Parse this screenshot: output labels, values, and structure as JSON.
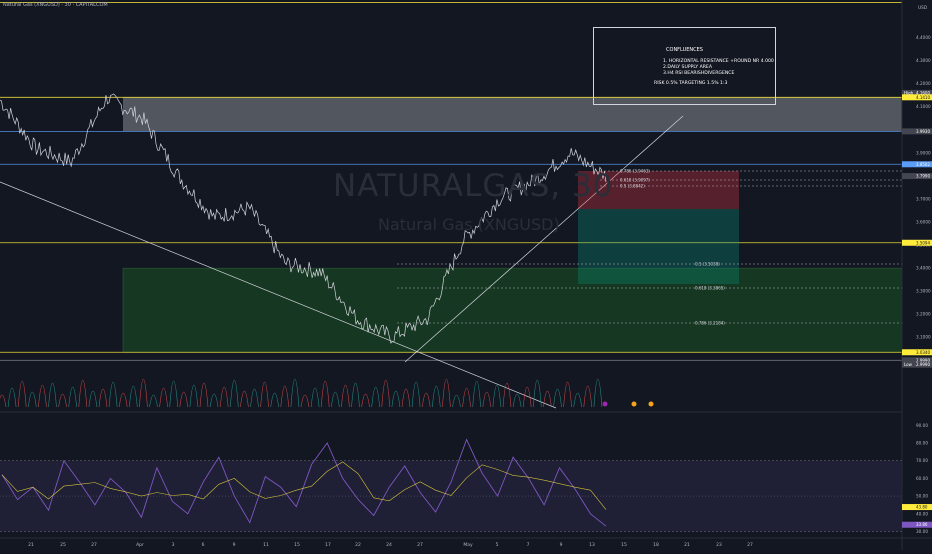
{
  "header": {
    "title": "Natural Gas (XNGUSD) · 30 · CAPITALCOM",
    "currency": "USD"
  },
  "watermark": {
    "symbol": "NATURALGAS, 30",
    "name": "Natural Gas (XNGUSD)"
  },
  "annotation": {
    "title": "CONFLUENCES",
    "lines": [
      "1. HORIZONTAL RESISTANCE +ROUND NR 4.000",
      "2.DAILY SUPPLY AREA",
      "3.H4 RSI BEARISHDIVERGENCE"
    ],
    "risk": "RISK 0.5% TARGETING 1.5% 1:3"
  },
  "price_axis": {
    "ticks": [
      "4.4000",
      "4.3000",
      "4.2000",
      "4.1000",
      "3.9000",
      "3.8000",
      "3.7000",
      "3.6000",
      "3.5000",
      "3.4000",
      "3.3000",
      "3.2000",
      "3.1000",
      "3.0000"
    ],
    "badges": [
      {
        "label": "High",
        "value": "4.1600",
        "color": "#434651"
      },
      {
        "label": "",
        "value": "4.1410",
        "color": "#ffeb3b"
      },
      {
        "label": "",
        "value": "3.9930",
        "color": "#434651"
      },
      {
        "label": "",
        "value": "3.8502",
        "color": "#5b9cf6"
      },
      {
        "label": "",
        "value": "3.7990",
        "color": "#434651"
      },
      {
        "label": "",
        "value": "3.5094",
        "color": "#ffeb3b"
      },
      {
        "label": "",
        "value": "3.0340",
        "color": "#ffeb3b"
      },
      {
        "label": "",
        "value": "2.9990",
        "color": "#434651"
      },
      {
        "label": "Low",
        "value": "2.9990",
        "color": "#434651"
      }
    ]
  },
  "fib_labels": [
    {
      "text": "0.786 (3.9463)"
    },
    {
      "text": "0.618 (3.9097)"
    },
    {
      "text": "0.5 (3.8842)"
    },
    {
      "text": "0.5 (3.5038)"
    },
    {
      "text": "0.618 (3.3865)"
    },
    {
      "text": "0.786 (3.2184)"
    }
  ],
  "rsi_axis": {
    "ticks": [
      "90.00",
      "80.00",
      "70.00",
      "60.00",
      "50.00",
      "40.00",
      "30.00"
    ],
    "badges": [
      {
        "value": "43.80"
      },
      {
        "value": "33.80"
      }
    ]
  },
  "time_axis": {
    "ticks": [
      "21",
      "25",
      "27",
      "Apr",
      "3",
      "6",
      "9",
      "11",
      "15",
      "17",
      "22",
      "24",
      "27",
      "May",
      "5",
      "7",
      "9",
      "13",
      "15",
      "18",
      "21",
      "23",
      "27"
    ]
  },
  "colors": {
    "background": "#131722",
    "supply_zone": "#c9cbd1",
    "demand_zone": "#1b5e20",
    "yellow_line": "#ffeb3b",
    "short_stop": "#f23645",
    "short_target": "#089981",
    "rsi_band": "#7e57c2",
    "rsi_line": "#7e57c2",
    "rsi_ma": "#ffeb3b"
  },
  "chart_data": {
    "type": "line",
    "title": "Natural Gas (XNGUSD) · 30 · CAPITALCOM",
    "xlabel": "",
    "ylabel": "",
    "ylim": [
      2.97,
      4.52
    ],
    "x": [
      "Mar 21",
      "Mar 25",
      "Mar 27",
      "Apr 1",
      "Apr 3",
      "Apr 6",
      "Apr 9",
      "Apr 11",
      "Apr 15",
      "Apr 17",
      "Apr 22",
      "Apr 24",
      "Apr 27",
      "May 1",
      "May 5",
      "May 7",
      "May 9",
      "May 13"
    ],
    "series": [
      {
        "values": [
          4.13,
          3.92,
          3.86,
          4.14,
          4.05,
          3.8,
          3.62,
          3.66,
          3.42,
          3.38,
          3.18,
          3.1,
          3.18,
          3.52,
          3.7,
          3.78,
          3.9,
          3.8
        ]
      }
    ],
    "levels": [
      4.141,
      3.993,
      3.8502,
      3.5094,
      3.034,
      2.999
    ],
    "supply_zone": [
      3.993,
      4.141
    ],
    "demand_zone": [
      3.034,
      3.399
    ],
    "rsi": {
      "ylim": [
        28,
        93
      ],
      "overbought": 70,
      "oversold": 30,
      "values": [
        62,
        48,
        55,
        42,
        70,
        58,
        45,
        60,
        52,
        38,
        66,
        47,
        40,
        58,
        72,
        50,
        35,
        61,
        55,
        44,
        68,
        80,
        60,
        48,
        39,
        55,
        67,
        52,
        41,
        58,
        82,
        63,
        50,
        72,
        60,
        45,
        66,
        54,
        40,
        33
      ]
    }
  }
}
